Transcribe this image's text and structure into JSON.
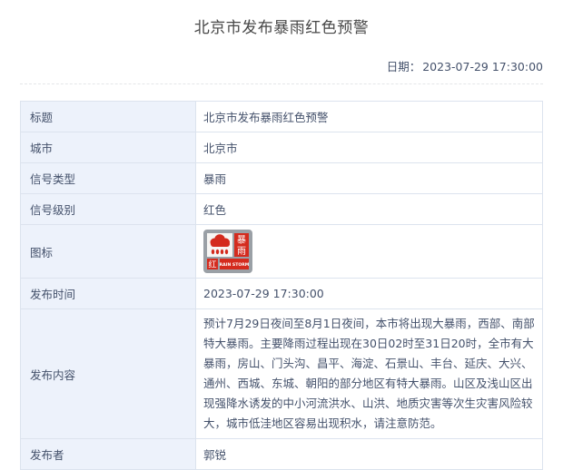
{
  "page": {
    "title": "北京市发布暴雨红色预警",
    "date_label": "日期：",
    "date_value": "2023-07-29 17:30:00"
  },
  "table": {
    "rows": [
      {
        "label": "标题",
        "value": "北京市发布暴雨红色预警"
      },
      {
        "label": "城市",
        "value": "北京市"
      },
      {
        "label": "信号类型",
        "value": "暴雨"
      },
      {
        "label": "信号级别",
        "value": "红色"
      },
      {
        "label": "图标",
        "value": ""
      },
      {
        "label": "发布时间",
        "value": "2023-07-29 17:30:00"
      },
      {
        "label": "发布内容",
        "value": "预计7月29日夜间至8月1日夜间，本市将出现大暴雨，西部、南部特大暴雨。主要降雨过程出现在30日02时至31日20时，全市有大暴雨，房山、门头沟、昌平、海淀、石景山、丰台、延庆、大兴、通州、西城、东城、朝阳的部分地区有特大暴雨。山区及浅山区出现强降水诱发的中小河流洪水、山洪、地质灾害等次生灾害风险较大，城市低洼地区容易出现积水，请注意防范。"
      },
      {
        "label": "发布者",
        "value": "郭锐"
      }
    ]
  },
  "icon": {
    "name": "rainstorm-red-warning-icon",
    "char_top": "暴",
    "char_bottom": "雨",
    "level_char": "红",
    "english": "RAIN STORM"
  },
  "colors": {
    "accent_red": "#d42b1e",
    "icon_frame_grey": "#9aa0a6",
    "label_cell_bg": "#edf2fb",
    "table_border": "#dce3ee",
    "text": "#44516b"
  }
}
